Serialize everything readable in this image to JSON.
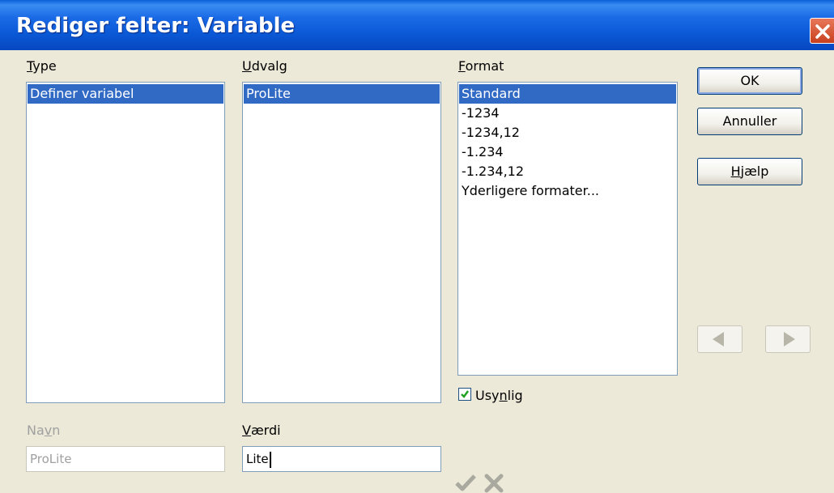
{
  "window": {
    "title": "Rediger felter: Variable"
  },
  "type": {
    "label_u": "T",
    "label_rest": "ype",
    "items": [
      "Definer variabel"
    ]
  },
  "udvalg": {
    "label_u": "U",
    "label_rest": "dvalg",
    "items": [
      "ProLite"
    ]
  },
  "format": {
    "label_u": "F",
    "label_rest": "ormat",
    "items": [
      "Standard",
      "-1234",
      "-1234,12",
      "-1.234",
      "-1.234,12",
      "Yderligere formater..."
    ],
    "invisible_label_pre": "Usy",
    "invisible_label_u": "n",
    "invisible_label_post": "lig",
    "invisible_checked": true
  },
  "navn": {
    "label_pre": "Na",
    "label_u": "v",
    "label_post": "n",
    "value": "ProLite"
  },
  "vaerdi": {
    "label_u": "V",
    "label_rest": "ærdi",
    "value": "Lite"
  },
  "buttons": {
    "ok": "OK",
    "cancel": "Annuller",
    "help_u": "H",
    "help_rest": "jælp"
  },
  "colors": {
    "selection": "#316ac5",
    "titlebar": "#0a57d4",
    "dialog_bg": "#ece9d8"
  }
}
